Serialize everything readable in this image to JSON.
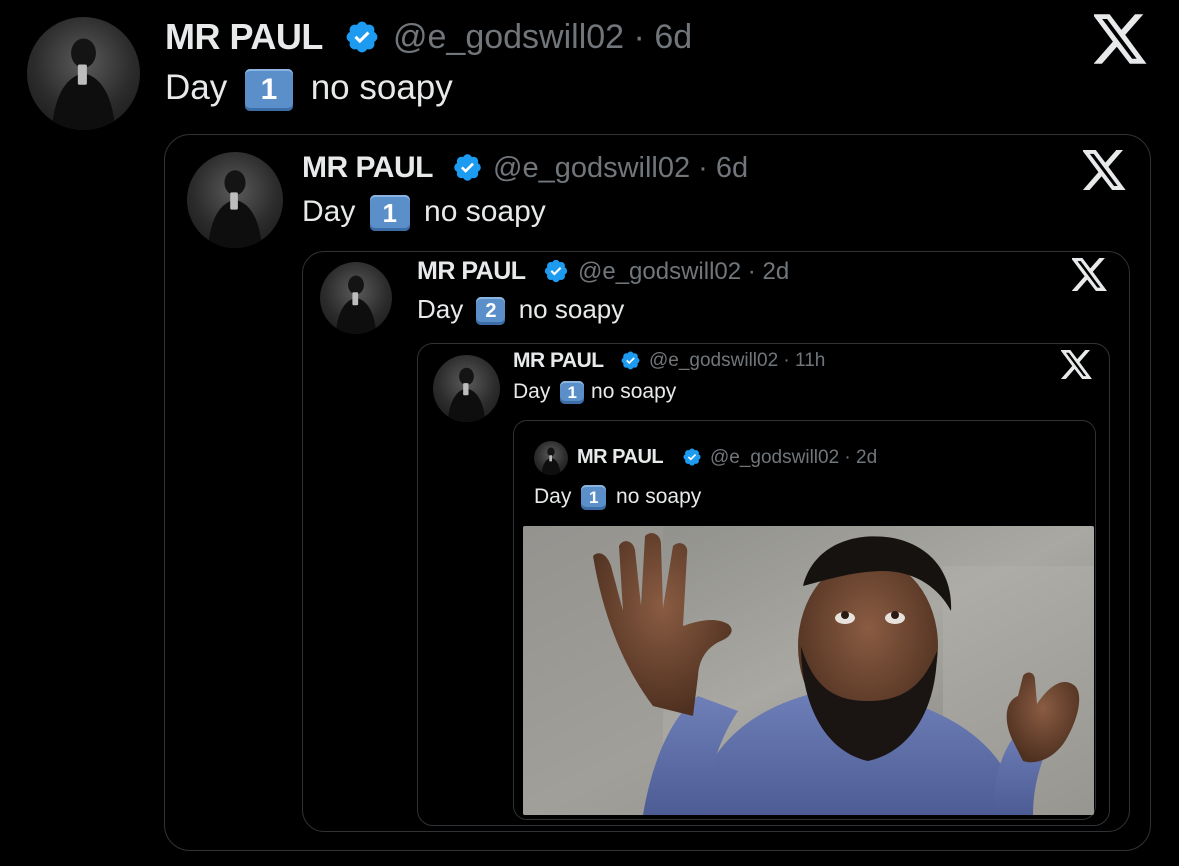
{
  "posts": [
    {
      "name": "MR PAUL",
      "handle": "@e_godswill02",
      "time": "6d",
      "text_prefix": "Day",
      "day": "1",
      "text_suffix": "no soapy"
    },
    {
      "name": "MR PAUL",
      "handle": "@e_godswill02",
      "time": "6d",
      "text_prefix": "Day",
      "day": "1",
      "text_suffix": "no soapy"
    },
    {
      "name": "MR PAUL",
      "handle": "@e_godswill02",
      "time": "2d",
      "text_prefix": "Day",
      "day": "2",
      "text_suffix": "no soapy"
    },
    {
      "name": "MR PAUL",
      "handle": "@e_godswill02",
      "time": "11h",
      "text_prefix": "Day",
      "day": "1",
      "text_suffix": "no soapy"
    },
    {
      "name": "MR PAUL",
      "handle": "@e_godswill02",
      "time": "2d",
      "text_prefix": "Day",
      "day": "1",
      "text_suffix": "no soapy"
    }
  ],
  "separator": "·",
  "colors": {
    "background": "#000000",
    "text": "#e7e9ea",
    "muted": "#71767b",
    "verified": "#1d9bf0",
    "border": "#2f3336",
    "keycap": "#5b8fc9"
  },
  "icons": {
    "brand": "x-logo-icon",
    "verified": "verified-badge-icon"
  }
}
